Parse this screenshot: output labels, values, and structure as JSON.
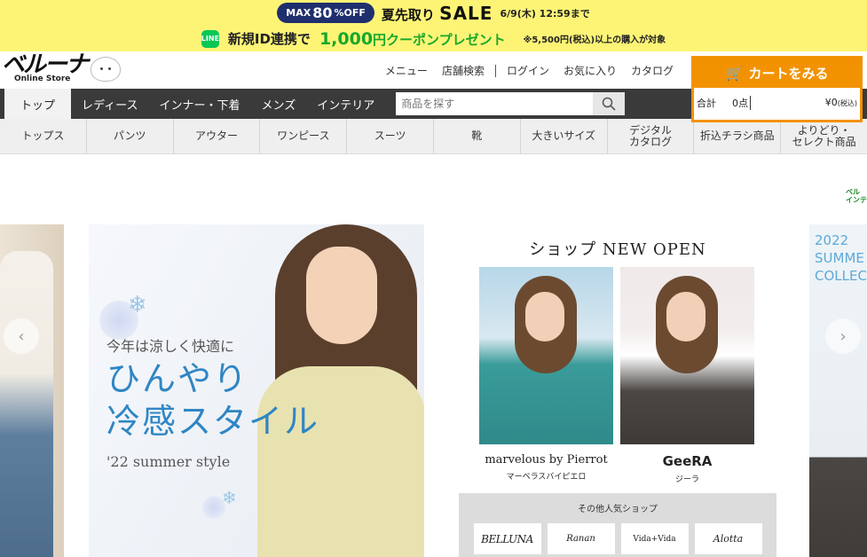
{
  "sale_bar": {
    "pill_prefix": "MAX",
    "pill_value": "80",
    "pill_suffix": "%OFF",
    "title": "夏先取り",
    "sale_word": "SALE",
    "deadline": "6/9(木) 12:59まで"
  },
  "line_bar": {
    "icon_text": "LINE",
    "text": "新規ID連携で",
    "coupon_amount": "1,000",
    "coupon_text": "円クーポンプレゼント",
    "note": "※5,500円(税込)以上の購入が対象"
  },
  "header": {
    "logo_text": "ベルーナ",
    "logo_sub": "Online Store",
    "links": [
      "メニュー",
      "店舗検索",
      "ログイン",
      "お気に入り",
      "カタログ"
    ]
  },
  "cart": {
    "button_label": "カートをみる",
    "total_label": "合計",
    "count": "0点",
    "price": "¥0",
    "tax": "(税込)"
  },
  "nav": {
    "tabs": [
      "トップ",
      "レディース",
      "インナー・下着",
      "メンズ",
      "インテリア"
    ],
    "search_placeholder": "商品を探す"
  },
  "categories": [
    "トップス",
    "パンツ",
    "アウター",
    "ワンピース",
    "スーツ",
    "靴",
    "大きいサイズ",
    "デジタル\nカタログ",
    "折込チラシ商品",
    "よりどり・\nセレクト商品"
  ],
  "corner_logo": "ベル\nインテ",
  "banner": {
    "sub": "今年は涼しく快適に",
    "title_line1": "ひんやり",
    "title_line2": "冷感スタイル",
    "en": "'22 summer style"
  },
  "shop": {
    "title": "ショップ NEW OPEN",
    "shops": [
      {
        "name": "marvelous by Pierrot",
        "kana": "マーベラスバイピエロ"
      },
      {
        "name": "GeeRA",
        "kana": "ジーラ"
      }
    ],
    "other_title": "その他人気ショップ",
    "brands": [
      "BELLUNA",
      "Ranan",
      "Vida+Vida",
      "Alotta"
    ]
  },
  "side_right": {
    "text_lines": [
      "2022",
      "SUMME",
      "COLLEC"
    ]
  },
  "colors": {
    "sale_yellow": "#fdf476",
    "cart_orange": "#f39200",
    "nav_dark": "#3a3a3a",
    "line_green": "#06c755",
    "coupon_green": "#18a72a",
    "banner_blue": "#2f86c4"
  }
}
